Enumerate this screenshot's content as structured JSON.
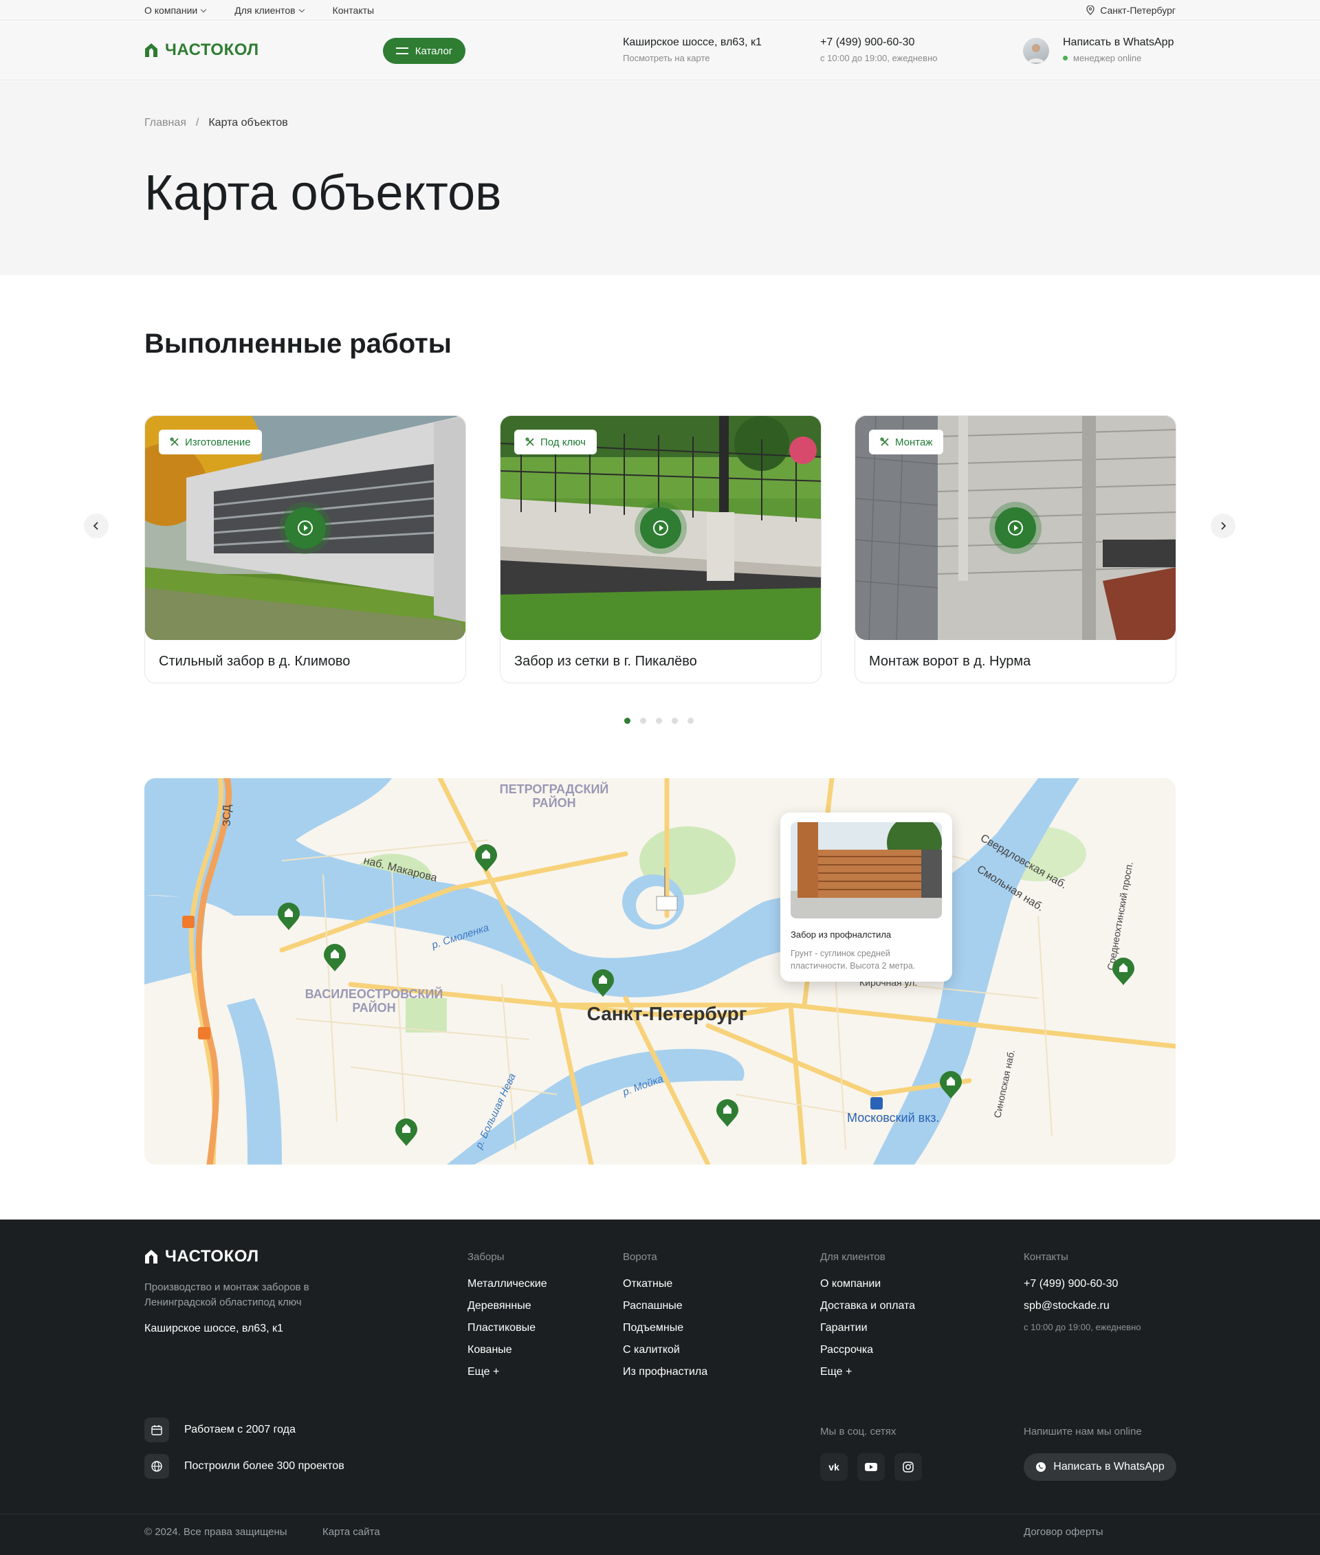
{
  "topbar": {
    "nav": [
      {
        "label": "О компании",
        "dropdown": true
      },
      {
        "label": "Для клиентов",
        "dropdown": true
      },
      {
        "label": "Контакты",
        "dropdown": false
      }
    ],
    "city": "Санкт-Петербург"
  },
  "header": {
    "logo": "ЧАСТОКОЛ",
    "catalog_label": "Каталог",
    "address": "Каширское шоссе, вл63, к1",
    "address_sub": "Посмотреть на карте",
    "phone": "+7 (499) 900-60-30",
    "phone_sub": "с 10:00 до 19:00, ежедневно",
    "whatsapp": "Написать в WhatsApp",
    "whatsapp_sub": "менеджер online"
  },
  "breadcrumbs": {
    "home": "Главная",
    "separator": "/",
    "current": "Карта объектов"
  },
  "page_title": "Карта объектов",
  "works": {
    "title": "Выполненные работы",
    "cards": [
      {
        "tag": "Изготовление",
        "caption": "Стильный забор в д. Климово"
      },
      {
        "tag": "Под ключ",
        "caption": "Забор из сетки в г. Пикалёво"
      },
      {
        "tag": "Монтаж",
        "caption": "Монтаж ворот в д. Нурма"
      }
    ],
    "dots_total": 5,
    "dot_active": 1
  },
  "map": {
    "labels": {
      "district1": "ПЕТРОГРАДСКИЙ",
      "district1b": "РАЙОН",
      "district2": "ВАСИЛЕОСТРОВСКИЙ",
      "district2b": "РАЙОН",
      "city": "Санкт-Петербург",
      "street1": "наб. Макарова",
      "street2": "р. Смоленка",
      "street3": "Свердловская наб.",
      "street4": "Смольная наб.",
      "street5": "Среднеохтинский просп.",
      "street6": "Кирочная ул.",
      "street7": "Синопская наб.",
      "street8": "р. Мойка",
      "street9": "р. Большая Нева",
      "station": "Московский вкз.",
      "road": "ЗСД"
    },
    "popup": {
      "title": "Забор из профналстила",
      "desc": "Грунт - суглинок средней пластичности. Высота 2 метра."
    }
  },
  "footer": {
    "logo": "ЧАСТОКОЛ",
    "desc": "Производство и монтаж заборов в Ленинградской областипод ключ",
    "address": "Каширское шоссе, вл63, к1",
    "cols": {
      "fences": {
        "title": "Заборы",
        "items": [
          "Металлические",
          "Деревянные",
          "Пластиковые",
          "Кованые",
          "Еще +"
        ]
      },
      "gates": {
        "title": "Ворота",
        "items": [
          "Откатные",
          "Распашные",
          "Подъемные",
          "С калиткой",
          "Из профнастила"
        ]
      },
      "clients": {
        "title": "Для клиентов",
        "items": [
          "О компании",
          "Доставка и оплата",
          "Гарантии",
          "Рассрочка",
          "Еще +"
        ]
      },
      "contacts": {
        "title": "Контакты",
        "phone": "+7 (499) 900-60-30",
        "email": "spb@stockade.ru",
        "hours": "с 10:00 до 19:00, ежедневно"
      }
    },
    "badges": [
      "Работаем с 2007 года",
      "Построили более 300 проектов"
    ],
    "social_title": "Мы в соц. сетях",
    "social": [
      "vk-icon",
      "youtube-icon",
      "instagram-icon"
    ],
    "online_title": "Напишите нам мы online",
    "whatsapp_btn": "Написать в WhatsApp",
    "copyright": "© 2024. Все права защищены",
    "sitemap": "Карта сайта",
    "offer": "Договор оферты"
  },
  "colors": {
    "brand": "#2e7d32",
    "footer_bg": "#1c1f21",
    "hero_bg": "#f5f5f5"
  }
}
